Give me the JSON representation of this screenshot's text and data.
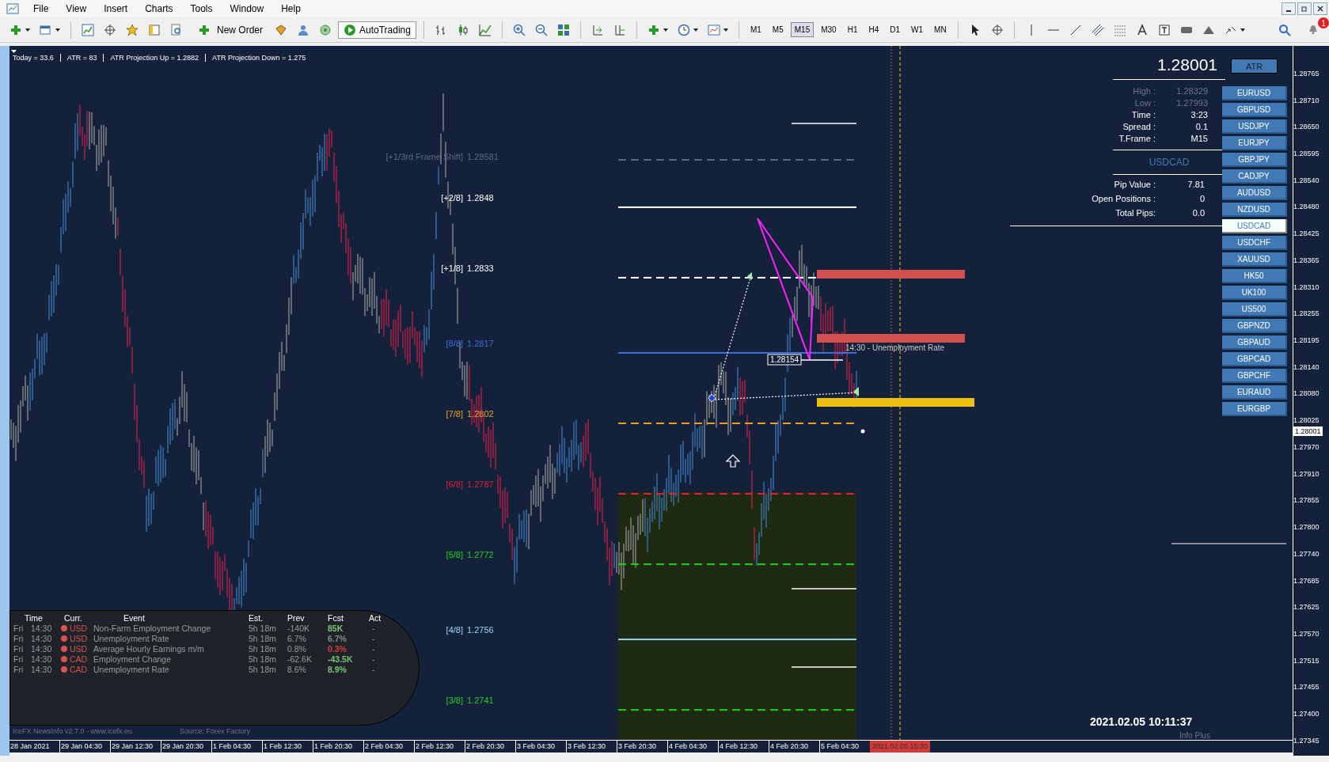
{
  "menu": [
    "File",
    "View",
    "Insert",
    "Charts",
    "Tools",
    "Window",
    "Help"
  ],
  "toolbar": {
    "new_order": "New Order",
    "autotrading": "AutoTrading",
    "notification_count": "1",
    "timeframes": [
      {
        "label": "M1",
        "selected": false
      },
      {
        "label": "M5",
        "selected": false
      },
      {
        "label": "M15",
        "selected": true
      },
      {
        "label": "M30",
        "selected": false
      },
      {
        "label": "H1",
        "selected": false
      },
      {
        "label": "H4",
        "selected": false
      },
      {
        "label": "D1",
        "selected": false
      },
      {
        "label": "W1",
        "selected": false
      },
      {
        "label": "MN",
        "selected": false
      }
    ]
  },
  "info_bar": [
    "Today = 33.6",
    "ATR = 83",
    "ATR Projection Up = 1.2882",
    "ATR Projection Down = 1.275"
  ],
  "murrey_levels": [
    {
      "label": "[+1/3rd Frame Shift]",
      "price": "1.28581",
      "color": "#5c6b80",
      "dashed": true
    },
    {
      "label": "[+2/8]",
      "price": "1.2848",
      "color": "#ffffff",
      "dashed": false
    },
    {
      "label": "[+1/8]",
      "price": "1.2833",
      "color": "#ffffff",
      "dashed": true
    },
    {
      "label": "[8/8]",
      "price": "1.2817",
      "color": "#3f6fe0",
      "dashed": false
    },
    {
      "label": "[7/8]",
      "price": "1.2802",
      "color": "#f0a020",
      "dashed": true
    },
    {
      "label": "[6/8]",
      "price": "1.2787",
      "color": "#e0203a",
      "dashed": true
    },
    {
      "label": "[5/8]",
      "price": "1.2772",
      "color": "#20d020",
      "dashed": true
    },
    {
      "label": "[4/8]",
      "price": "1.2756",
      "color": "#9fd3f0",
      "dashed": false
    },
    {
      "label": "[3/8]",
      "price": "1.2741",
      "color": "#20d020",
      "dashed": true
    }
  ],
  "chart_labels": {
    "price_tag": "1.28154",
    "event": "14:30 - Unemployment Rate"
  },
  "panel": {
    "button": "ATR",
    "price": "1.28001",
    "stats": [
      {
        "label": "High :",
        "value": "1.28329",
        "dim": true
      },
      {
        "label": "Low :",
        "value": "1.27993",
        "dim": true
      },
      {
        "label": "Time :",
        "value": "3:23",
        "dim": false
      },
      {
        "label": "Spread :",
        "value": "0.1",
        "dim": false
      },
      {
        "label": "T.Frame :",
        "value": "M15",
        "dim": false
      }
    ],
    "symbol": "USDCAD",
    "account": [
      {
        "label": "Pip Value :",
        "value": "7.81"
      },
      {
        "label": "Open Positions :",
        "value": "0"
      },
      {
        "label": "Total Pips:",
        "value": "0.0"
      }
    ]
  },
  "symbols": [
    {
      "label": "EURUSD",
      "selected": false
    },
    {
      "label": "GBPUSD",
      "selected": false
    },
    {
      "label": "USDJPY",
      "selected": false
    },
    {
      "label": "EURJPY",
      "selected": false
    },
    {
      "label": "GBPJPY",
      "selected": false
    },
    {
      "label": "CADJPY",
      "selected": false
    },
    {
      "label": "AUDUSD",
      "selected": false
    },
    {
      "label": "NZDUSD",
      "selected": false
    },
    {
      "label": "USDCAD",
      "selected": true
    },
    {
      "label": "USDCHF",
      "selected": false
    },
    {
      "label": "XAUUSD",
      "selected": false
    },
    {
      "label": "HK50",
      "selected": false
    },
    {
      "label": "UK100",
      "selected": false
    },
    {
      "label": "US500",
      "selected": false
    },
    {
      "label": "GBPNZD",
      "selected": false
    },
    {
      "label": "GBPAUD",
      "selected": false
    },
    {
      "label": "GBPCAD",
      "selected": false
    },
    {
      "label": "GBPCHF",
      "selected": false
    },
    {
      "label": "EURAUD",
      "selected": false
    },
    {
      "label": "EURGBP",
      "selected": false
    }
  ],
  "news": {
    "columns": [
      "Time",
      "Curr.",
      "Event",
      "Est.",
      "Prev",
      "Fcst",
      "Act"
    ],
    "rows": [
      {
        "day": "Fri",
        "time": "14:30",
        "currency": "USD",
        "event": "Non-Farm Employment Change",
        "est": "5h 18m",
        "prev": "-140K",
        "fcst": "85K",
        "color": "#7ac47a",
        "act": "-"
      },
      {
        "day": "Fri",
        "time": "14:30",
        "currency": "USD",
        "event": "Unemployment Rate",
        "est": "5h 18m",
        "prev": "6.7%",
        "fcst": "6.7%",
        "color": "#8a8a8a",
        "act": "-"
      },
      {
        "day": "Fri",
        "time": "14:30",
        "currency": "USD",
        "event": "Average Hourly Earnings m/m",
        "est": "5h 18m",
        "prev": "0.8%",
        "fcst": "0.3%",
        "color": "#d04040",
        "act": "-"
      },
      {
        "day": "Fri",
        "time": "14:30",
        "currency": "CAD",
        "event": "Employment Change",
        "est": "5h 18m",
        "prev": "-62.6K",
        "fcst": "-43.5K",
        "color": "#7ac47a",
        "act": "-"
      },
      {
        "day": "Fri",
        "time": "14:30",
        "currency": "CAD",
        "event": "Unemployment Rate",
        "est": "5h 18m",
        "prev": "8.6%",
        "fcst": "8.9%",
        "color": "#7ac47a",
        "act": "-"
      }
    ],
    "footer": "IceFX NewsInfo v2.7.0  -  www.icefx.eu",
    "source": "Source: Forex Factory"
  },
  "price_axis": {
    "ticks": [
      "1.28765",
      "1.28710",
      "1.28650",
      "1.28595",
      "1.28540",
      "1.28480",
      "1.28425",
      "1.28365",
      "1.28310",
      "1.28255",
      "1.28195",
      "1.28140",
      "1.28080",
      "1.28025",
      "1.27970",
      "1.27910",
      "1.27855",
      "1.27800",
      "1.27740",
      "1.27685",
      "1.27625",
      "1.27570",
      "1.27515",
      "1.27455",
      "1.27400",
      "1.27345"
    ],
    "current": "1.28001"
  },
  "time_axis": {
    "labels": [
      "28 Jan 2021",
      "29 Jan 04:30",
      "29 Jan 12:30",
      "29 Jan 20:30",
      "1 Feb 04:30",
      "1 Feb 12:30",
      "1 Feb 20:30",
      "2 Feb 04:30",
      "2 Feb 12:30",
      "2 Feb 20:30",
      "3 Feb 04:30",
      "3 Feb 12:30",
      "3 Feb 20:30",
      "4 Feb 04:30",
      "4 Feb 12:30",
      "4 Feb 20:30",
      "5 Feb 04:30"
    ],
    "cursor": "2021.02.05 15:30"
  },
  "clock": {
    "time": "2021.02.05 10:11:37",
    "caption": "Info Plus"
  }
}
